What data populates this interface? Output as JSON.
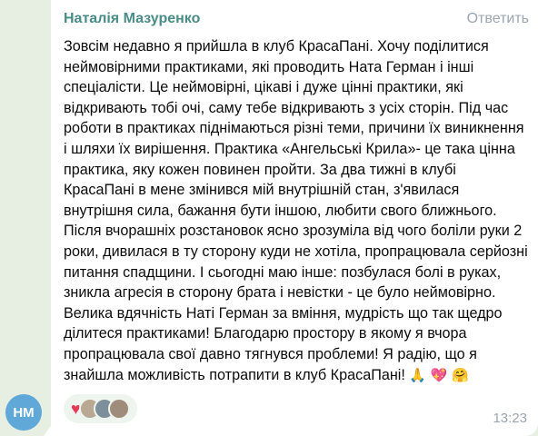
{
  "message": {
    "sender": "Наталія Мазуренко",
    "reply_label": "Ответить",
    "text": "Зовсім недавно я прийшла в клуб КрасаПані. Хочу поділитися неймовірними практиками, які проводить Ната Герман і інші спеціалісти. Це неймовірні, цікаві і дуже цінні практики, які відкривають тобі очі, саму тебе відкривають з усіх сторін. Під час роботи в практиках піднімаються різні теми, причини їх виникнення і шляхи їх вирішення. Практика «Ангельські Крила»- це така цінна практика, яку кожен повинен пройти. За два тижні в клубі КрасаПані в мене змінився мій внутрішній стан, з'явилася внутрішня сила, бажання бути іншою, любити свого ближнього. Після вчорашніх розстановок ясно зрозуміла від чого боліли руки 2 роки, дивилася в ту сторону куди не хотіла, пропрацювала серйозні питання спадщини. І сьогодні маю інше: позбулася болі в руках, зникла агресія в сторону брата і невістки - це було неймовірно. Велика вдячність Наті Герман за вміння, мудрість що так щедро ділитеся практиками! Благодарю простору в якому я вчора пропрацювала свої давно тягнувся проблеми! Я радію, що я знайшла можливість потрапити в клуб КрасаПані!",
    "emojis": "🙏 💖 🤗",
    "time": "13:23",
    "avatar_initials": "НМ",
    "reaction_emoji": "♥"
  },
  "colors": {
    "sender": "#4a8c87",
    "avatar": "#5fa8d8",
    "heart": "#e53955"
  }
}
